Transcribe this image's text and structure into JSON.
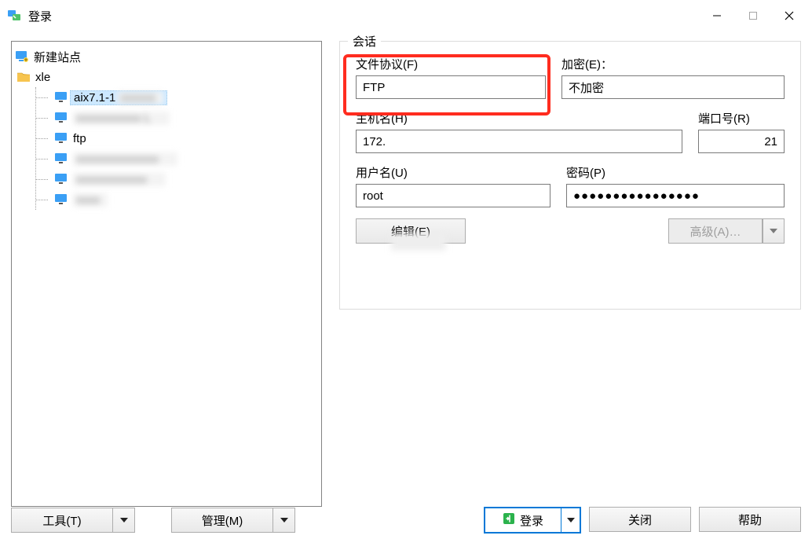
{
  "title": "登录",
  "tree": {
    "newSite": "新建站点",
    "folder": "xle",
    "items": [
      {
        "label": "aix7.1-1",
        "selected": true,
        "blurred_tail": true
      },
      {
        "label": "",
        "blurred": true
      },
      {
        "label": "ftp"
      },
      {
        "label": "",
        "blurred": true
      },
      {
        "label": "",
        "blurred": true
      },
      {
        "label": "",
        "blurred": true
      }
    ]
  },
  "session": {
    "legend": "会话",
    "protocolLabel": "文件协议(F)",
    "protocolValue": "FTP",
    "encryptionLabel": "加密(E)：",
    "encryptionValue": "不加密",
    "hostLabel": "主机名(H)",
    "hostValue": "172.",
    "portLabel": "端口号(R)",
    "portValue": "21",
    "userLabel": "用户名(U)",
    "userValue": "root",
    "passLabel": "密码(P)",
    "passValue": "●●●●●●●●●●●●●●●●",
    "editBtn": "编辑(E)",
    "advancedBtn": "高级(A)…"
  },
  "footer": {
    "toolsBtn": "工具(T)",
    "manageBtn": "管理(M)",
    "loginBtn": "登录",
    "closeBtn": "关闭",
    "helpBtn": "帮助"
  }
}
